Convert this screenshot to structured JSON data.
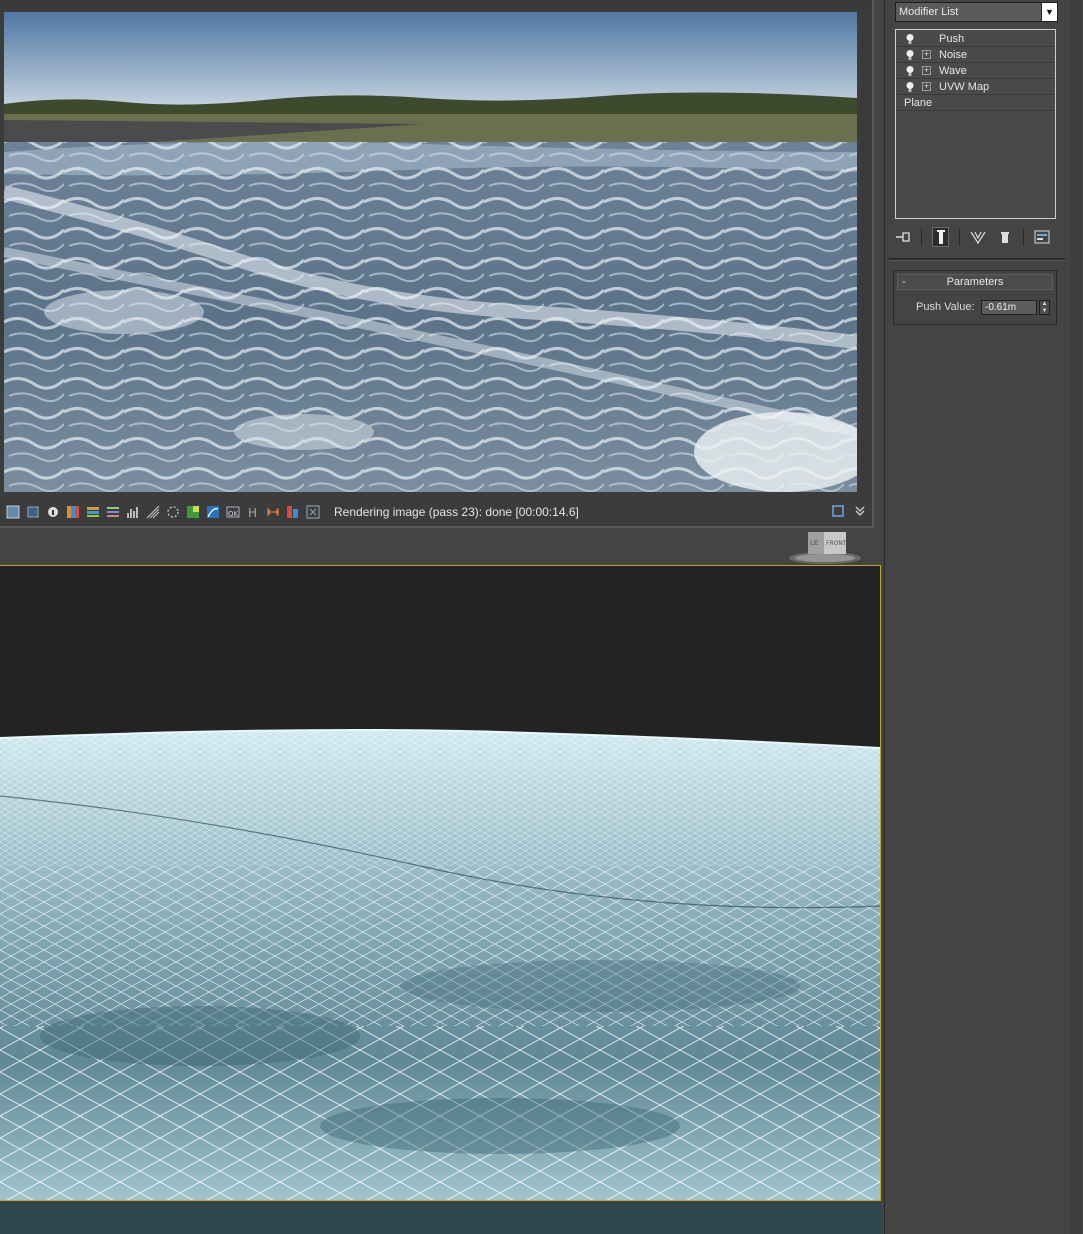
{
  "frame_buffer": {
    "status_text": "Rendering image (pass 23): done [00:00:14.6]",
    "toolbar_icons": [
      "save-icon",
      "copy-icon",
      "info-icon",
      "color-correction-icon",
      "lut-icon",
      "curves-icon",
      "histogram-icon",
      "stamp-icon",
      "lens-effects-icon",
      "region-icon",
      "exposure-icon",
      "history-icon",
      "h-icon",
      "compare-icon",
      "stereo-icon",
      "track-mouse-icon"
    ],
    "right_icons": [
      "fit-window-icon",
      "expand-icon"
    ]
  },
  "viewcube": {
    "face_left": "LE",
    "face_front": "FRONT"
  },
  "command_panel": {
    "modifier_list_label": "Modifier List",
    "stack": [
      {
        "label": "Push",
        "has_bulb": true,
        "has_plus": false
      },
      {
        "label": "Noise",
        "has_bulb": true,
        "has_plus": true
      },
      {
        "label": "Wave",
        "has_bulb": true,
        "has_plus": true
      },
      {
        "label": "UVW Map",
        "has_bulb": true,
        "has_plus": true
      },
      {
        "label": "Plane",
        "has_bulb": false,
        "has_plus": false
      }
    ],
    "stack_tools": [
      "pin-stack-icon",
      "show-end-result-icon",
      "make-unique-icon",
      "remove-modifier-icon",
      "configure-sets-icon"
    ],
    "rollout": {
      "toggle": "-",
      "title": "Parameters",
      "push_value_label": "Push Value:",
      "push_value": "-0.61m"
    }
  }
}
